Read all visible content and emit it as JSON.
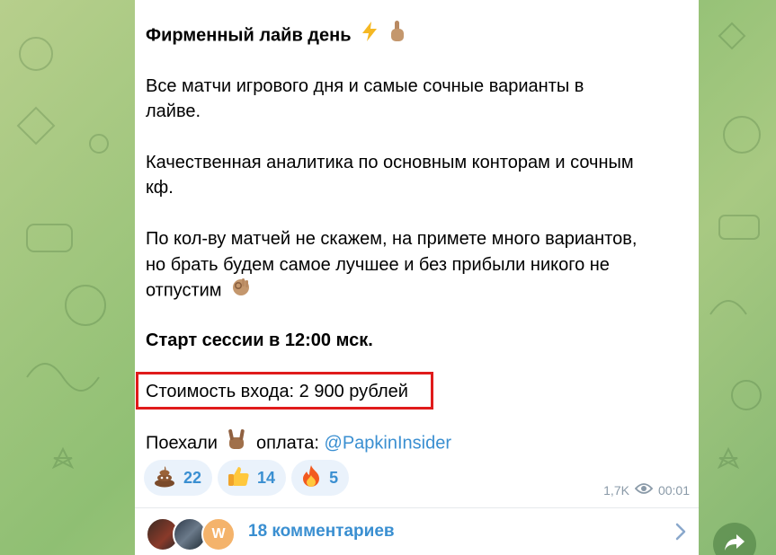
{
  "post": {
    "title": "Фирменный лайв день",
    "title_icons": [
      "lightning-icon",
      "pointing-up-icon"
    ],
    "para1_line1": "Все матчи игрового дня и самые сочные варианты в",
    "para1_line2": "лайве.",
    "para2_line1": "Качественная аналитика по основным конторам и сочным",
    "para2_line2": "кф.",
    "para3_line1": "По кол-ву матчей не скажем, на примете много вариантов,",
    "para3_line2": "но брать будем самое лучшее и без прибыли никого не",
    "para3_line3": "отпустим",
    "para3_icon": "ok-hand-icon",
    "start": "Старт сессии в 12:00 мск.",
    "price": "Стоимость входа: 2 900 рублей",
    "go_prefix": "Поехали",
    "go_icon": "rock-hand-icon",
    "payment_label": "оплата:",
    "payment_link": "@PapkinInsider"
  },
  "reactions": [
    {
      "icon": "poop-icon",
      "count": "22"
    },
    {
      "icon": "thumbs-up-icon",
      "count": "14"
    },
    {
      "icon": "fire-icon",
      "count": "5"
    }
  ],
  "meta": {
    "views": "1,7K",
    "time": "00:01",
    "icon": "eye-icon"
  },
  "comments": {
    "label": "18 комментариев",
    "avatar_initials": "W"
  },
  "colors": {
    "accent": "#3a8fd1",
    "highlight": "#e01b1b",
    "background": "#9cc47b"
  }
}
